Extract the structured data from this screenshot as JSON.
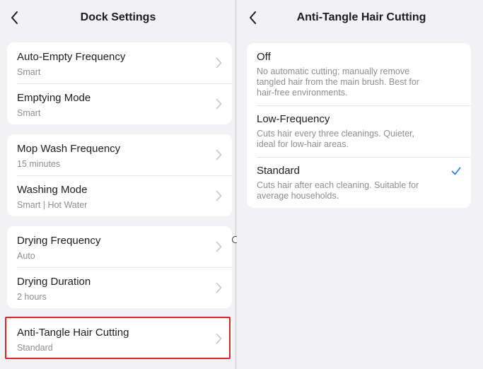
{
  "left": {
    "title": "Dock Settings",
    "groups": [
      {
        "items": [
          {
            "label": "Auto-Empty Frequency",
            "value": "Smart"
          },
          {
            "label": "Emptying Mode",
            "value": "Smart"
          }
        ]
      },
      {
        "items": [
          {
            "label": "Mop Wash Frequency",
            "value": "15 minutes"
          },
          {
            "label": "Washing Mode",
            "value": "Smart | Hot Water"
          }
        ]
      },
      {
        "items": [
          {
            "label": "Drying Frequency",
            "value": "Auto"
          },
          {
            "label": "Drying Duration",
            "value": "2 hours"
          }
        ]
      },
      {
        "items": [
          {
            "label": "Anti-Tangle Hair Cutting",
            "value": "Standard"
          }
        ]
      }
    ]
  },
  "right": {
    "title": "Anti-Tangle Hair Cutting",
    "options": [
      {
        "title": "Off",
        "description": "No automatic cutting; manually remove tangled hair from the main brush. Best for hair-free environments.",
        "selected": false
      },
      {
        "title": "Low-Frequency",
        "description": "Cuts hair every three cleanings. Quieter, ideal for low-hair areas.",
        "selected": false
      },
      {
        "title": "Standard",
        "description": "Cuts hair after each cleaning. Suitable for average households.",
        "selected": true
      }
    ]
  },
  "colors": {
    "accent": "#2f80ed",
    "highlight": "#d9252b",
    "background": "#f2f2f5"
  },
  "icons": {
    "back": "chevron-left-icon",
    "row": "chevron-right-icon",
    "selected": "checkmark-icon"
  }
}
